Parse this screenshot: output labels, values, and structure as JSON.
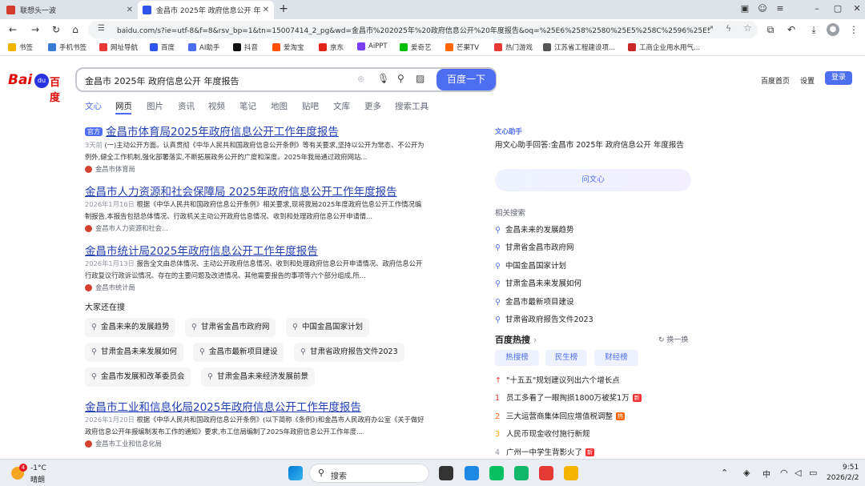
{
  "tabs": [
    {
      "title": "联想头一波",
      "active": false
    },
    {
      "title": "金昌市 2025年 政府信息公开 年度",
      "active": true
    }
  ],
  "address": "baidu.com/s?ie=utf-8&f=8&rsv_bp=1&tn=15007414_2_pg&wd=金昌市%202025年%20政府信息公开%20年度报告&oq=%25E6%258%2580%25E5%258C%2596%25E5%25B8%2582%...",
  "bookmarks": [
    "书签",
    "手机书签",
    "网址导航",
    "百度",
    "AI助手",
    "抖音",
    "爱淘宝",
    "京东",
    "AiPPT",
    "爱奇艺",
    "芒果TV",
    "热门游戏",
    "江苏省工程建设项...",
    "工商企业用水用气..."
  ],
  "logo": {
    "bai": "Bai",
    "du": "du",
    "cn": "百度"
  },
  "search": {
    "query": "金昌市 2025年 政府信息公开 年度报告",
    "button": "百度一下"
  },
  "header": {
    "home": "百度首页",
    "settings": "设置",
    "login": "登录"
  },
  "search_tabs": [
    "文心",
    "网页",
    "图片",
    "资讯",
    "视频",
    "笔记",
    "地图",
    "贴吧",
    "文库",
    "更多",
    "搜索工具"
  ],
  "results": [
    {
      "badge": "官方",
      "title": "金昌市体育局2025年政府信息公开工作年度报告",
      "snippet_date": "3天前",
      "snippet": "(一)主动公开方面。认真贯彻《中华人民共和国政府信息公开条例》等有关要求,坚持以公开为常态、不公开为例外,健全工作机制,强化部署落实,不断拓展政务公开的广度和深度。2025年我局通过政府网站...",
      "source": "金昌市体育局"
    },
    {
      "title": "金昌市人力资源和社会保障局 2025年政府信息公开工作年度报告",
      "snippet_date": "2026年1月16日",
      "snippet": "根据《中华人民共和国政府信息公开条例》相关要求,现将我局2025年度政府信息公开工作情况编制报告,本报告包括总体情况、行政机关主动公开政府信息情况、收到和处理政府信息公开申请情...",
      "source": "金昌市人力资源和社会..."
    },
    {
      "title": "金昌市统计局2025年政府信息公开工作年度报告",
      "snippet_date": "2026年1月13日",
      "snippet": "报告全文由总体情况、主动公开政府信息情况、收到和处理政府信息公开申请情况、政府信息公开行政复议行政诉讼情况、存在的主要问题及改进情况、其他需要报告的事项等六个部分组成,所...",
      "source": "金昌市统计局"
    },
    {
      "title": "金昌市工业和信息化局2025年政府信息公开工作年度报告",
      "snippet_date": "2026年1月20日",
      "snippet": "根据《中华人民共和国政府信息公开条例》(以下简称《条例》)和金昌市人民政府办公室《关于做好政府信息公开年报编制发布工作的通知》要求,市工信局编制了2025年政府信息公开工作年度...",
      "source": "金昌市工业和信息化局"
    }
  ],
  "people_also": {
    "title": "大家还在搜",
    "items": [
      "金昌未来的发展趋势",
      "甘肃省金昌市政府网",
      "中国金昌国家计划",
      "甘肃金昌未来发展如何",
      "金昌市最新项目建设",
      "甘肃省政府报告文件2023",
      "金昌市发展和改革委员会",
      "甘肃金昌未来经济发展前景"
    ]
  },
  "ai": {
    "title": "文心助手",
    "text": "用文心助手回答:金昌市 2025年 政府信息公开 年度报告",
    "button": "问文心"
  },
  "related": {
    "title": "相关搜索",
    "items": [
      "金昌未来的发展趋势",
      "甘肃省金昌市政府网",
      "中国金昌国家计划",
      "甘肃金昌未来发展如何",
      "金昌市最新项目建设",
      "甘肃省政府报告文件2023"
    ]
  },
  "hot": {
    "title": "百度热搜",
    "refresh": "换一换",
    "tabs": [
      "热搜榜",
      "民生榜",
      "财经榜"
    ],
    "items": [
      {
        "rank": "↑",
        "text": "\"十五五\"规划建议列出六个增长点",
        "tag": ""
      },
      {
        "rank": "1",
        "text": "员工多看了一眼掏损1800万被奖1万",
        "tag": "新"
      },
      {
        "rank": "2",
        "text": "三大运营商集体回应增值税调整",
        "tag": "热"
      },
      {
        "rank": "3",
        "text": "人民币现金收付施行新规",
        "tag": ""
      },
      {
        "rank": "4",
        "text": "广州一中学生背影火了",
        "tag": "新"
      }
    ]
  },
  "taskbar": {
    "temp": "-1°C",
    "weather": "晴朗",
    "weather_badge": "4",
    "search": "搜索",
    "ime": "中",
    "time": "9:51",
    "date": "2026/2/2"
  },
  "colors": {
    "accent": "#4e6ef2",
    "link": "#2440b3",
    "highlight": "#f73131"
  }
}
